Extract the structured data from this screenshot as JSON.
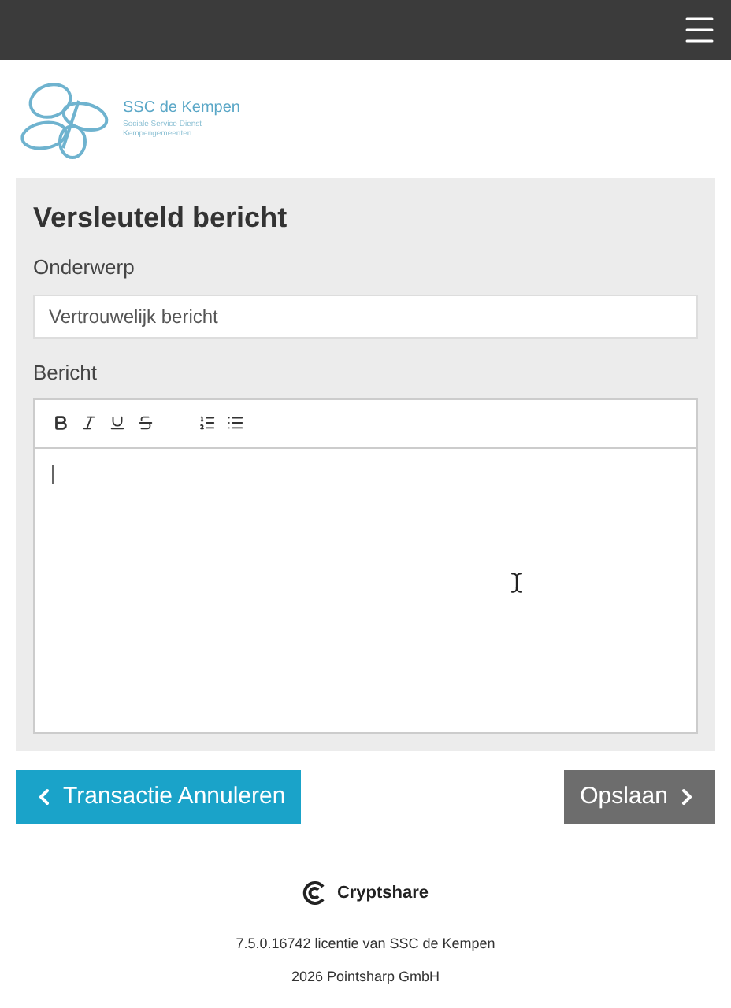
{
  "logo": {
    "name": "SSC de Kempen",
    "tagline": [
      "Sociale Service Dienst",
      "Kempengemeenten"
    ]
  },
  "form": {
    "title": "Versleuteld bericht",
    "subject": {
      "label": "Onderwerp",
      "value": "Vertrouwelijk bericht"
    },
    "message": {
      "label": "Bericht"
    }
  },
  "buttons": [
    {
      "kind": "back",
      "label": "Transactie Annuleren"
    },
    {
      "kind": "next",
      "label": "Opslaan"
    }
  ],
  "footer": {
    "brand": "Cryptshare",
    "version": "7.5.0.16742 licentie van SSC de Kempen",
    "copyright": "2026 Pointsharp GmbH"
  }
}
